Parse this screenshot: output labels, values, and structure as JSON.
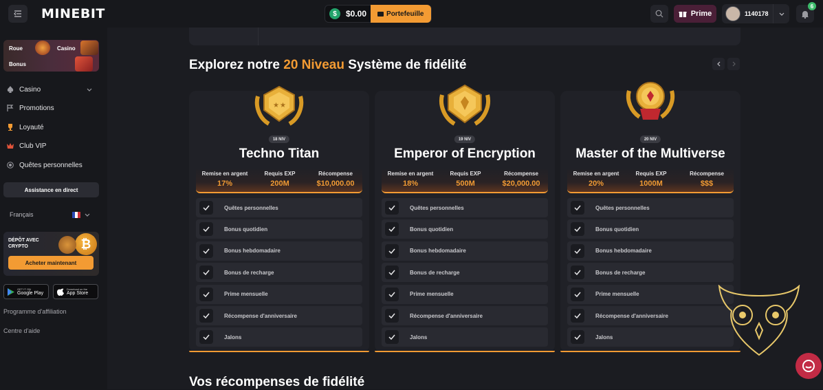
{
  "header": {
    "logo": "MINEBIT",
    "balance": "$0.00",
    "wallet_label": "Portefeuille",
    "prime_label": "Prime",
    "username": "1140178",
    "notification_count": "6"
  },
  "sidebar": {
    "promos": {
      "roue": "Roue",
      "casino": "Casino",
      "bonus": "Bonus"
    },
    "nav": [
      {
        "label": "Casino",
        "icon": "spade-icon"
      },
      {
        "label": "Promotions",
        "icon": "flag-icon"
      },
      {
        "label": "Loyauté",
        "icon": "trophy-icon"
      },
      {
        "label": "Club VIP",
        "icon": "crown-icon"
      },
      {
        "label": "Quêtes personnelles",
        "icon": "target-icon"
      }
    ],
    "assist_label": "Assistance en direct",
    "language": "Français",
    "crypto_title": "DÉPÔT AVEC CRYPTO",
    "buy_label": "Acheter maintenant",
    "google_small": "GET IT ON",
    "google_name": "Google Play",
    "apple_small": "Download on the",
    "apple_name": "App Store",
    "affiliate_label": "Programme d'affiliation",
    "help_label": "Centre d'aide"
  },
  "main": {
    "title_prefix": "Explorez notre ",
    "title_highlight": "20 Niveau",
    "title_suffix": " Système de fidélité",
    "stat_labels": [
      "Remise en argent",
      "Requis EXP",
      "Récompense"
    ],
    "features": [
      "Quêtes personnelles",
      "Bonus quotidien",
      "Bonus hebdomadaire",
      "Bonus de recharge",
      "Prime mensuelle",
      "Récompense d'anniversaire",
      "Jalons"
    ],
    "cards": [
      {
        "level": "18 NIV",
        "name": "Techno Titan",
        "cashback": "17%",
        "exp": "200M",
        "reward": "$10,000.00"
      },
      {
        "level": "19 NIV",
        "name": "Emperor of Encryption",
        "cashback": "18%",
        "exp": "500M",
        "reward": "$20,000.00"
      },
      {
        "level": "20 NIV",
        "name": "Master of the Multiverse",
        "cashback": "20%",
        "exp": "1000M",
        "reward": "$$$"
      }
    ],
    "bottom_title": "Vos récompenses de fidélité"
  },
  "colors": {
    "accent": "#f39b33",
    "gold": "#e0a52a",
    "prime": "#4a1f37",
    "chat": "#c22b45",
    "success": "#23a36b"
  }
}
